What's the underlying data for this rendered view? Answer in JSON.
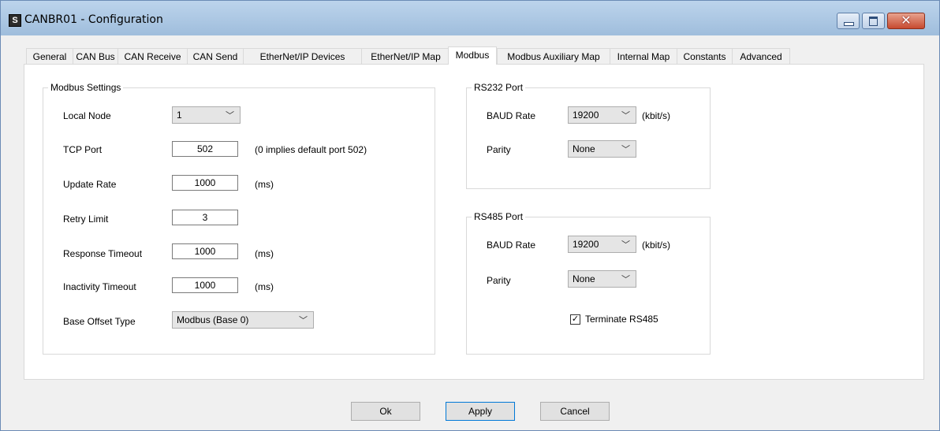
{
  "window": {
    "title": "CANBR01 - Configuration",
    "icon_glyph": "S",
    "minimize_icon": "minimize-icon",
    "maximize_icon": "maximize-icon",
    "close_glyph": "✕"
  },
  "tabs": [
    {
      "label": "General"
    },
    {
      "label": "CAN Bus"
    },
    {
      "label": "CAN Receive"
    },
    {
      "label": "CAN Send"
    },
    {
      "label": "EtherNet/IP Devices"
    },
    {
      "label": "EtherNet/IP Map"
    },
    {
      "label": "Modbus",
      "active": true
    },
    {
      "label": "Modbus Auxiliary Map"
    },
    {
      "label": "Internal Map"
    },
    {
      "label": "Constants"
    },
    {
      "label": "Advanced"
    }
  ],
  "modbus_settings": {
    "title": "Modbus Settings",
    "local_node": {
      "label": "Local Node",
      "value": "1"
    },
    "tcp_port": {
      "label": "TCP Port",
      "value": "502",
      "hint": "(0 implies default port 502)"
    },
    "update_rate": {
      "label": "Update Rate",
      "value": "1000",
      "unit": "(ms)"
    },
    "retry_limit": {
      "label": "Retry Limit",
      "value": "3"
    },
    "response_timeout": {
      "label": "Response Timeout",
      "value": "1000",
      "unit": "(ms)"
    },
    "inactivity_timeout": {
      "label": "Inactivity Timeout",
      "value": "1000",
      "unit": "(ms)"
    },
    "base_offset_type": {
      "label": "Base Offset Type",
      "value": "Modbus (Base 0)"
    }
  },
  "rs232": {
    "title": "RS232 Port",
    "baud": {
      "label": "BAUD Rate",
      "value": "19200",
      "unit": "(kbit/s)"
    },
    "parity": {
      "label": "Parity",
      "value": "None"
    }
  },
  "rs485": {
    "title": "RS485 Port",
    "baud": {
      "label": "BAUD Rate",
      "value": "19200",
      "unit": "(kbit/s)"
    },
    "parity": {
      "label": "Parity",
      "value": "None"
    },
    "terminate": {
      "label": "Terminate RS485",
      "checked": true,
      "check_glyph": "✓"
    }
  },
  "chevron": "﹀",
  "buttons": {
    "ok": "Ok",
    "apply": "Apply",
    "cancel": "Cancel"
  }
}
